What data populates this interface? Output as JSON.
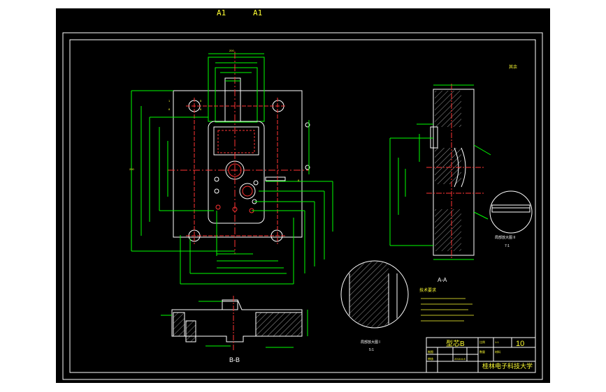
{
  "header": {
    "label_left": "A1",
    "label_right": "A1"
  },
  "drawing": {
    "corner_note": "其余",
    "section_aa": "A-A",
    "section_bb": "B-B",
    "tech_title": "技术要求",
    "detail1_label": "局部放大图 I",
    "detail1_scale": "5:1",
    "detail2_label": "局部放大图 II",
    "detail2_scale": "7:1"
  },
  "title_block": {
    "part_name": "型芯B",
    "sheet_no": "10",
    "school": "桂林电子科技大学",
    "scale_label": "比例",
    "scale_value": "1:1",
    "qty_label": "数量",
    "material": "材料",
    "drawn_label": "制图",
    "checked_label": "审核",
    "date": "2018.6.8"
  },
  "colors": {
    "background": "#000000",
    "outline": "#ffffff",
    "dimension": "#00ff00",
    "centerline": "#ff3333",
    "text": "#ffff33",
    "hatch": "#00ffff"
  }
}
